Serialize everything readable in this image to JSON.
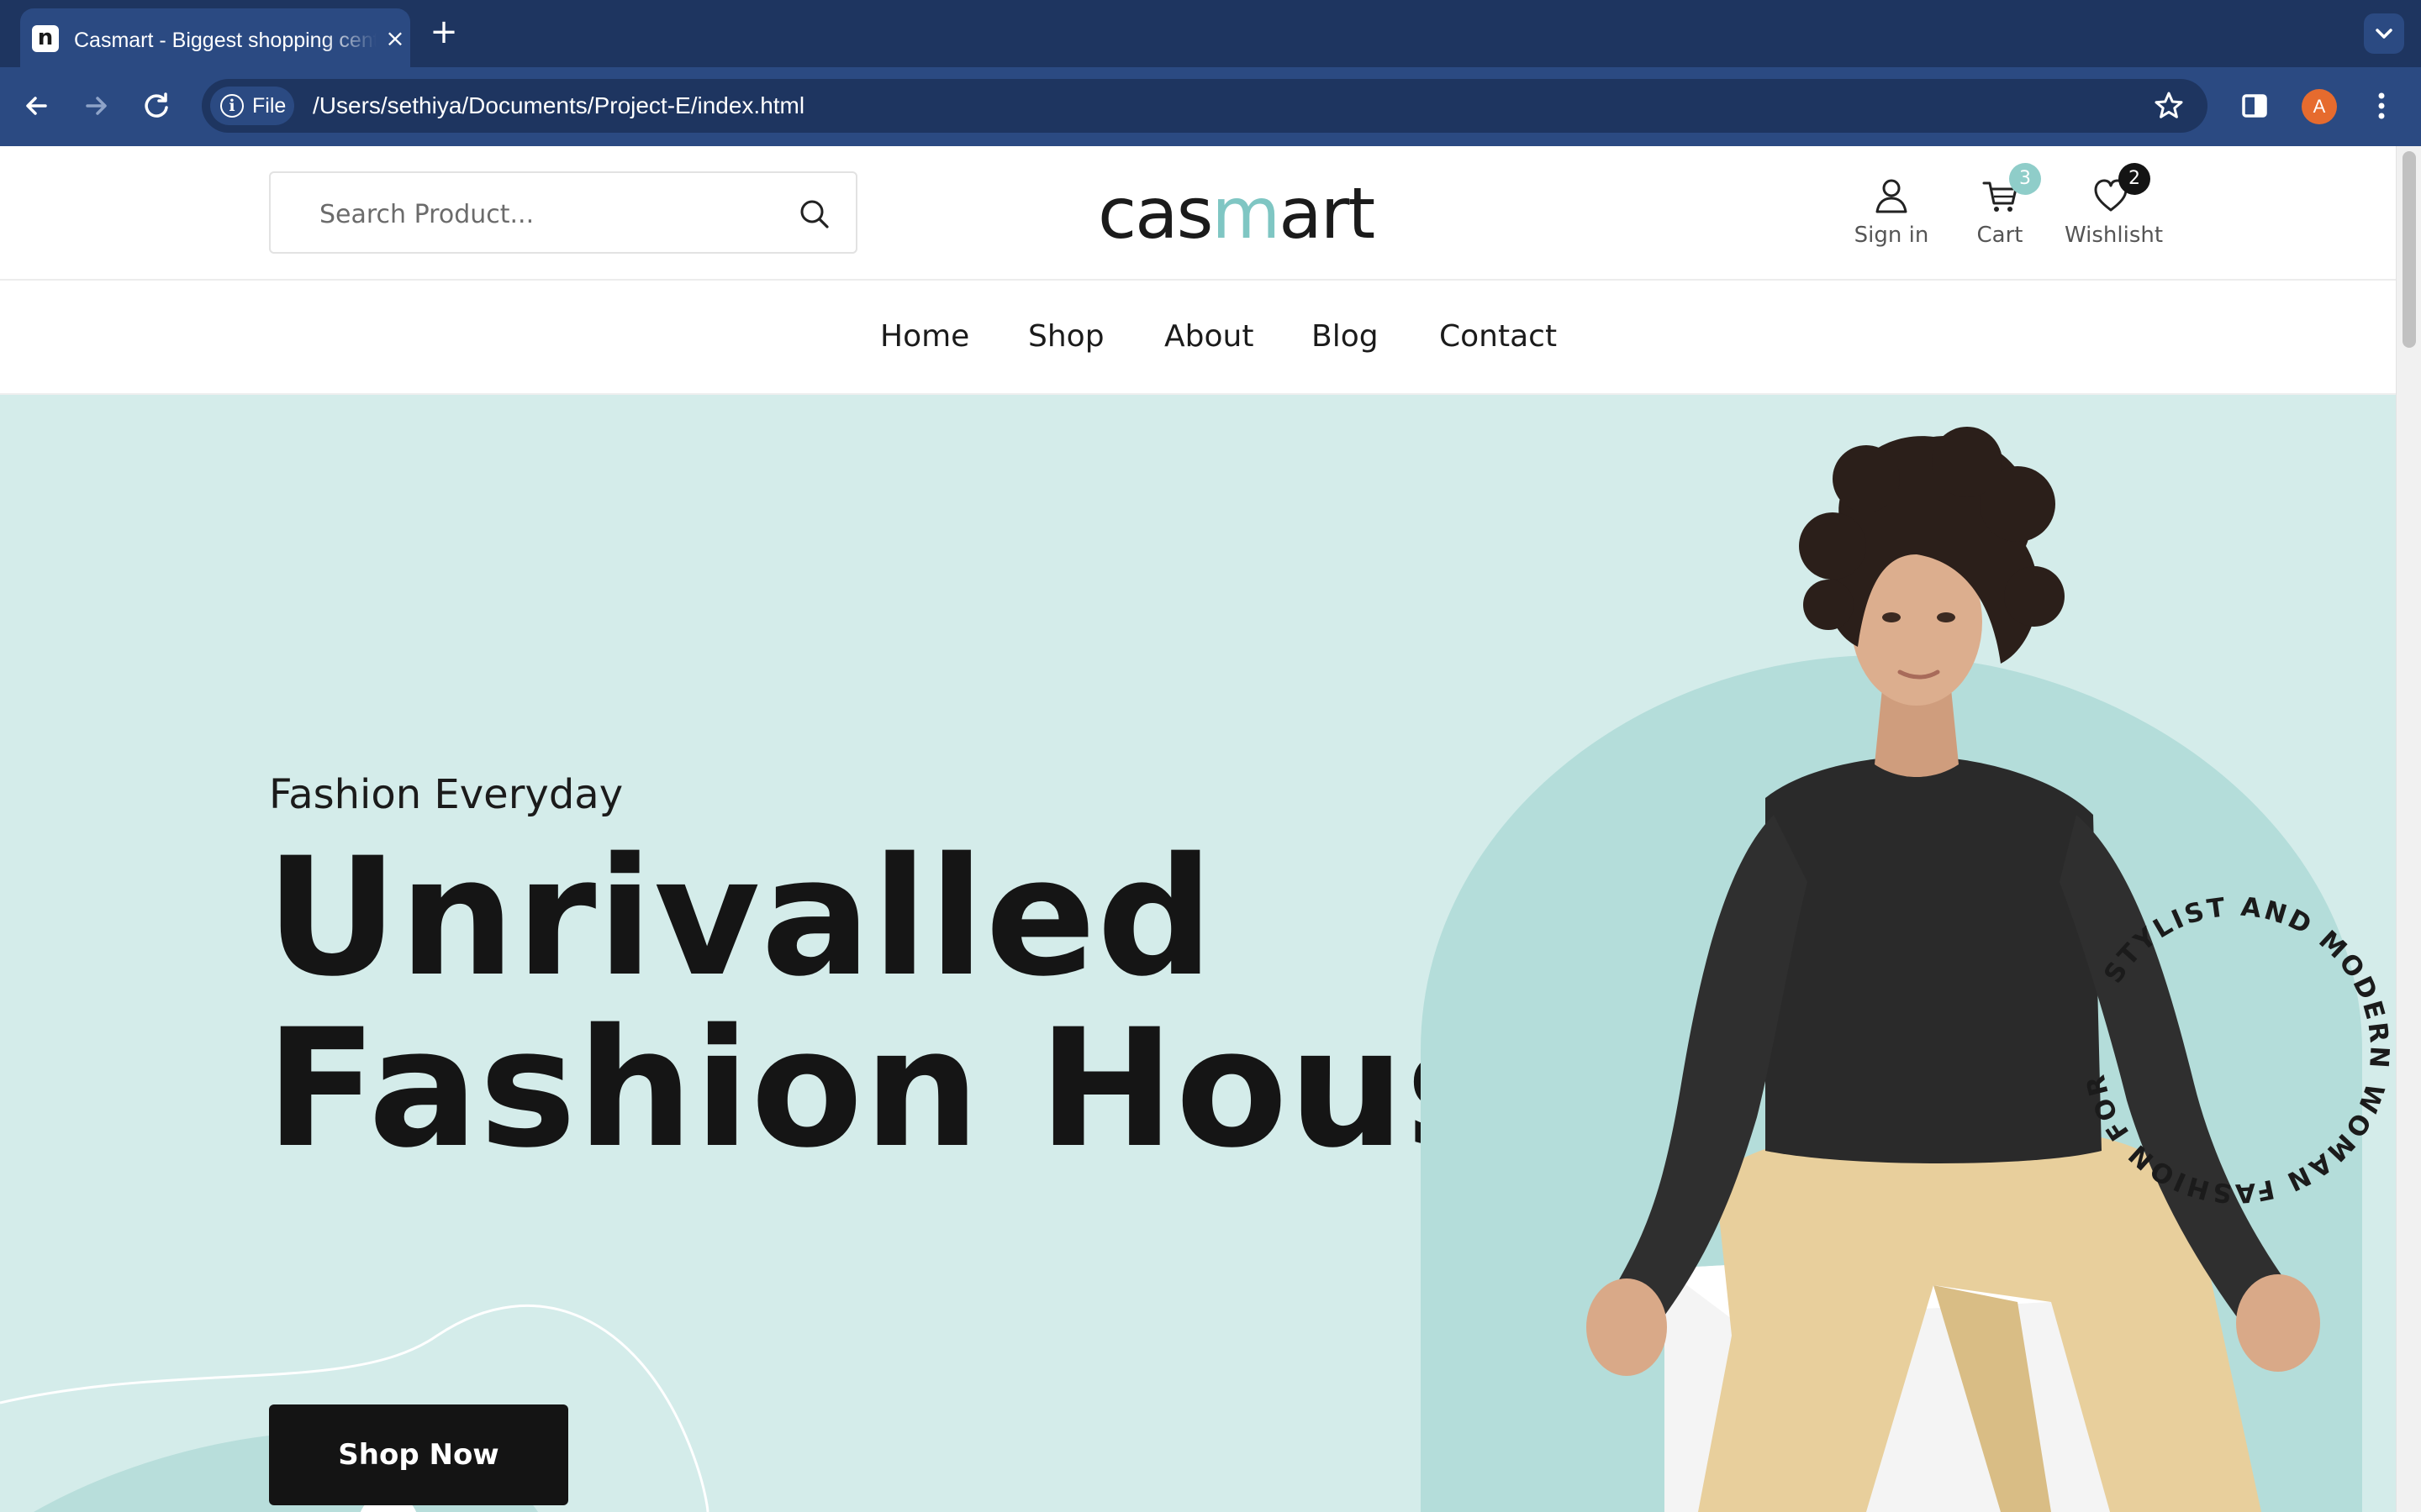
{
  "browser": {
    "tab_title": "Casmart - Biggest shopping center",
    "tab_favicon": "n",
    "new_tab": "+",
    "close": "×",
    "url_chip": "File",
    "url": "/Users/sethiya/Documents/Project-E/index.html",
    "profile_initial": "A",
    "icons": {
      "back": "arrow-left-icon",
      "forward": "arrow-right-icon",
      "reload": "reload-icon",
      "bookmark": "star-icon",
      "side_panel": "side-panel-icon",
      "menu": "kebab-menu-icon"
    },
    "colors": {
      "tabbar": "#1e3560",
      "toolbar": "#2b4a82",
      "profile": "#e66b2e"
    }
  },
  "header": {
    "search_placeholder": "Search Product...",
    "logo_pre": "cas",
    "logo_accent": "m",
    "logo_post": "art",
    "sign_in": "Sign in",
    "cart_label": "Cart",
    "cart_count": "3",
    "wishlist_label": "Wishlisht",
    "wishlist_count": "2"
  },
  "nav": {
    "items": [
      "Home",
      "Shop",
      "About",
      "Blog",
      "Contact"
    ]
  },
  "hero": {
    "eyebrow": "Fashion Everyday",
    "title_line1": "Unrivalled",
    "title_line2": "Fashion House",
    "cta": "Shop Now",
    "circle_text": "STYLIST AND MODERN WOMAN FASHION FOR UNRIVALLED WOMAN"
  },
  "colors": {
    "hero_bg": "#d4ecea",
    "arch": "#b4ddda",
    "accent": "#7fc6c3",
    "badge_cart": "#8fcdc9",
    "badge_wishlist": "#141414",
    "button": "#141414"
  }
}
